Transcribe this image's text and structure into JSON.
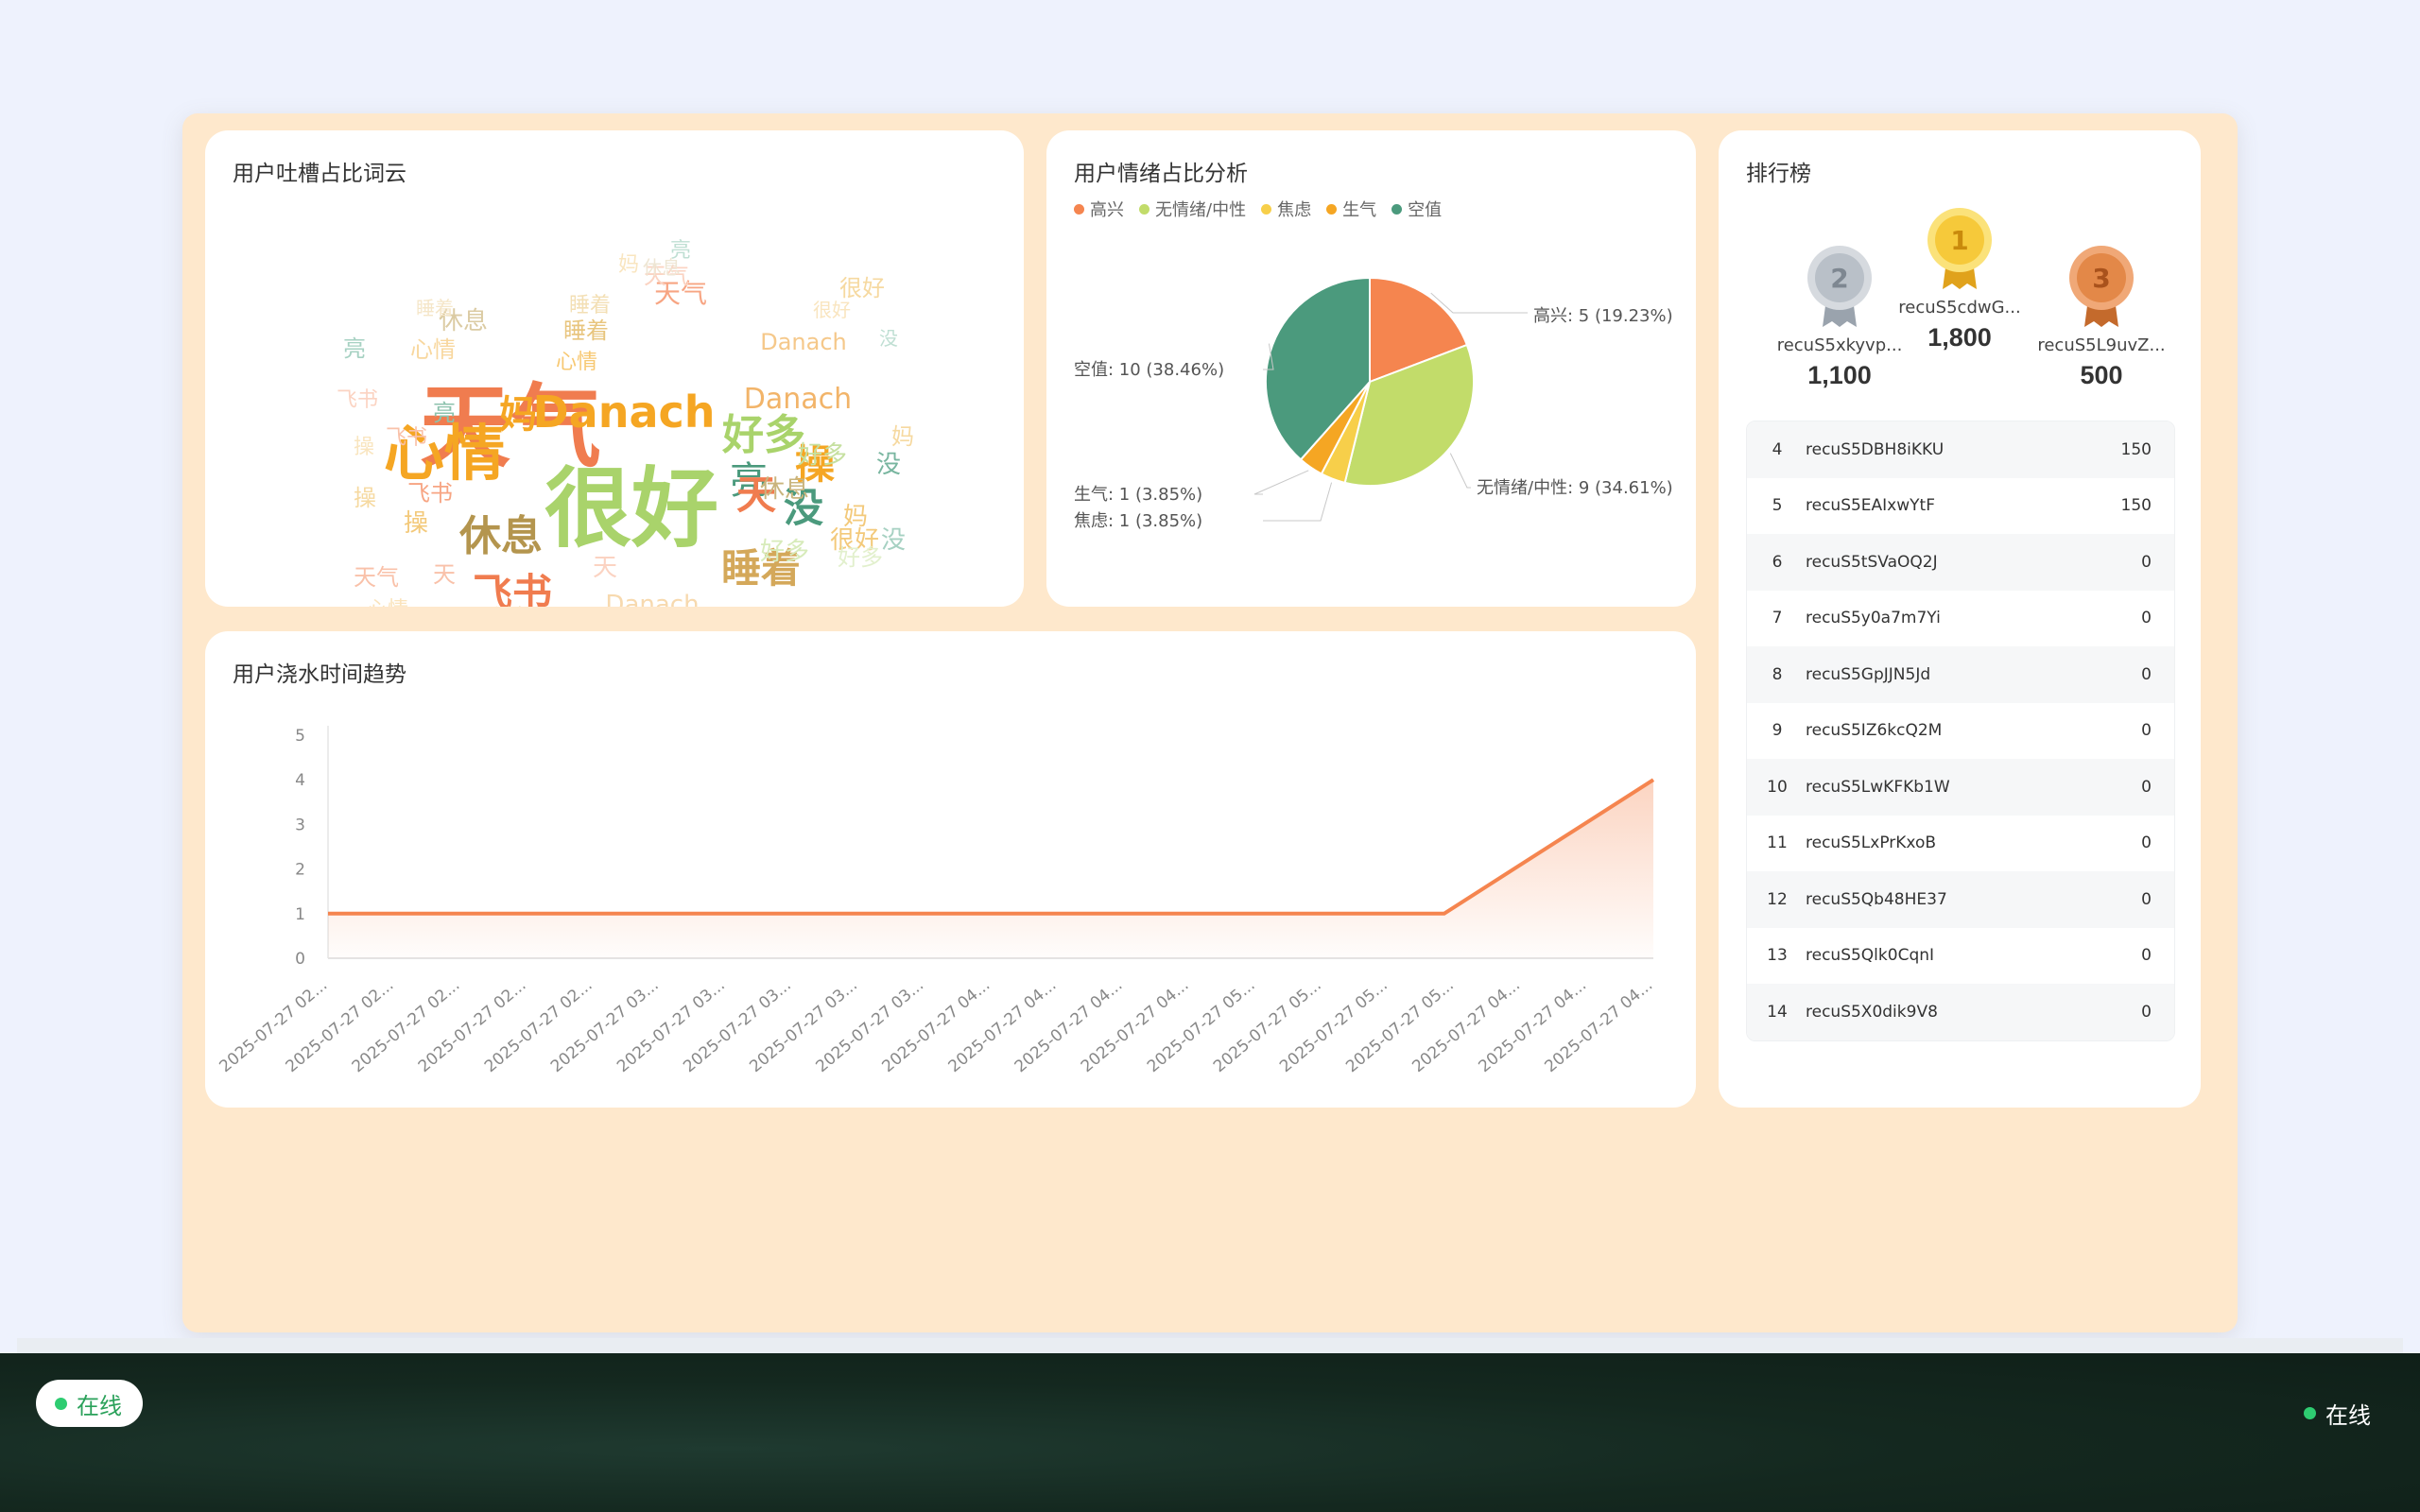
{
  "cards": {
    "wordcloud_title": "用户吐槽占比词云",
    "pie_title": "用户情绪占比分析",
    "trend_title": "用户浇水时间趋势",
    "rank_title": "排行榜"
  },
  "wordcloud_words": [
    {
      "text": "天气",
      "color": "#f07c4f"
    },
    {
      "text": "很好",
      "color": "#a9d36b"
    },
    {
      "text": "心情",
      "color": "#f5a623"
    },
    {
      "text": "Danach",
      "color": "#f5a623"
    },
    {
      "text": "妈",
      "color": "#f5a623"
    },
    {
      "text": "好多",
      "color": "#a9d36b"
    },
    {
      "text": "亮",
      "color": "#4b9a7d"
    },
    {
      "text": "操",
      "color": "#f5a623"
    },
    {
      "text": "天",
      "color": "#f07c4f"
    },
    {
      "text": "没",
      "color": "#4b9a7d"
    },
    {
      "text": "休息",
      "color": "#b4954e"
    },
    {
      "text": "飞书",
      "color": "#f07c4f"
    },
    {
      "text": "睡着",
      "color": "#d4a85a"
    },
    {
      "text": "心情",
      "color": "#f7c872"
    },
    {
      "text": "Danach",
      "color": "#f2b469"
    },
    {
      "text": "天气",
      "color": "#f7a583"
    },
    {
      "text": "休息",
      "color": "#c9b47d"
    },
    {
      "text": "好多",
      "color": "#c6e0a0"
    },
    {
      "text": "睡着",
      "color": "#e8c57e"
    },
    {
      "text": "很好",
      "color": "#f3c97a"
    },
    {
      "text": "没",
      "color": "#79b6a0"
    },
    {
      "text": "亮",
      "color": "#8cc2ad"
    },
    {
      "text": "飞书",
      "color": "#f7a583"
    },
    {
      "text": "操",
      "color": "#f3c97a"
    },
    {
      "text": "妈",
      "color": "#f3c97a"
    },
    {
      "text": "Danach",
      "color": "#f5c88a"
    },
    {
      "text": "休息",
      "color": "#dbcba3"
    },
    {
      "text": "天气",
      "color": "#f9c1a9"
    },
    {
      "text": "睡着",
      "color": "#f0d69f"
    },
    {
      "text": "好多",
      "color": "#d7ebba"
    },
    {
      "text": "心情",
      "color": "#f8d79e"
    },
    {
      "text": "亮",
      "color": "#a6d1c2"
    },
    {
      "text": "飞书",
      "color": "#f9c1a9"
    },
    {
      "text": "Danach",
      "color": "#f7d9ae"
    },
    {
      "text": "很好",
      "color": "#f6d9a0"
    },
    {
      "text": "天",
      "color": "#f9c1a9"
    },
    {
      "text": "没",
      "color": "#a6d1c2"
    },
    {
      "text": "操",
      "color": "#f6d9a0"
    },
    {
      "text": "休息",
      "color": "#e6dcc2"
    },
    {
      "text": "睡着",
      "color": "#f3dfb4"
    },
    {
      "text": "妈",
      "color": "#f6d9a0"
    },
    {
      "text": "天气",
      "color": "#fbd3c2"
    },
    {
      "text": "好多",
      "color": "#e2f0cd"
    },
    {
      "text": "心情",
      "color": "#fae3bb"
    },
    {
      "text": "飞书",
      "color": "#fbd3c2"
    },
    {
      "text": "亮",
      "color": "#bfdfd3"
    },
    {
      "text": "Danach",
      "color": "#f9e3c4"
    },
    {
      "text": "很好",
      "color": "#f9e5bf"
    },
    {
      "text": "休息",
      "color": "#eee6d4"
    },
    {
      "text": "睡着",
      "color": "#f5e6c8"
    },
    {
      "text": "天",
      "color": "#fbd3c2"
    },
    {
      "text": "操",
      "color": "#f9e5bf"
    },
    {
      "text": "妈",
      "color": "#f9e5bf"
    },
    {
      "text": "没",
      "color": "#bfdfd3"
    }
  ],
  "legend": [
    {
      "label": "高兴",
      "color": "#f5854f"
    },
    {
      "label": "无情绪/中性",
      "color": "#c2dc6a"
    },
    {
      "label": "焦虑",
      "color": "#f7cf4a"
    },
    {
      "label": "生气",
      "color": "#f5a623"
    },
    {
      "label": "空值",
      "color": "#4b9a7d"
    }
  ],
  "chart_data": [
    {
      "type": "pie",
      "title": "用户情绪占比分析",
      "categories": [
        "高兴",
        "无情绪/中性",
        "焦虑",
        "生气",
        "空值"
      ],
      "values": [
        5,
        9,
        1,
        1,
        10
      ],
      "labels": [
        "高兴: 5 (19.23%)",
        "无情绪/中性: 9 (34.61%)",
        "焦虑: 1 (3.85%)",
        "生气: 1 (3.85%)",
        "空值: 10 (38.46%)"
      ],
      "colors": [
        "#f5854f",
        "#c2dc6a",
        "#f7cf4a",
        "#f5a623",
        "#4b9a7d"
      ],
      "legend": "top-left"
    },
    {
      "type": "area",
      "title": "用户浇水时间趋势",
      "categories": [
        "2025-07-27 02...",
        "2025-07-27 02...",
        "2025-07-27 02...",
        "2025-07-27 02...",
        "2025-07-27 02...",
        "2025-07-27 03...",
        "2025-07-27 03...",
        "2025-07-27 03...",
        "2025-07-27 03...",
        "2025-07-27 03...",
        "2025-07-27 04...",
        "2025-07-27 04...",
        "2025-07-27 04...",
        "2025-07-27 04...",
        "2025-07-27 05...",
        "2025-07-27 05...",
        "2025-07-27 05...",
        "2025-07-27 05...",
        "2025-07-27 04...",
        "2025-07-27 04...",
        "2025-07-27 04..."
      ],
      "series": [
        {
          "values": [
            1,
            1,
            1,
            1,
            1,
            1,
            1,
            1,
            1,
            1,
            1,
            1,
            1,
            1,
            1,
            1,
            1,
            2,
            3,
            4
          ]
        }
      ],
      "yticks": [
        0,
        1,
        2,
        3,
        4,
        5
      ],
      "ylim": [
        0,
        5
      ],
      "grid": false,
      "color": "#f5854f"
    }
  ],
  "podium": [
    {
      "rank": "2",
      "name": "recuS5xkyvp...",
      "score": "1,100"
    },
    {
      "rank": "1",
      "name": "recuS5cdwG...",
      "score": "1,800"
    },
    {
      "rank": "3",
      "name": "recuS5L9uvZ...",
      "score": "500"
    }
  ],
  "ranking": [
    {
      "no": "4",
      "user": "recuS5DBH8iKKU",
      "score": "150"
    },
    {
      "no": "5",
      "user": "recuS5EAIxwYtF",
      "score": "150"
    },
    {
      "no": "6",
      "user": "recuS5tSVaOQ2J",
      "score": "0"
    },
    {
      "no": "7",
      "user": "recuS5y0a7m7Yi",
      "score": "0"
    },
    {
      "no": "8",
      "user": "recuS5GpJJN5Jd",
      "score": "0"
    },
    {
      "no": "9",
      "user": "recuS5IZ6kcQ2M",
      "score": "0"
    },
    {
      "no": "10",
      "user": "recuS5LwKFKb1W",
      "score": "0"
    },
    {
      "no": "11",
      "user": "recuS5LxPrKxoB",
      "score": "0"
    },
    {
      "no": "12",
      "user": "recuS5Qb48HE37",
      "score": "0"
    },
    {
      "no": "13",
      "user": "recuS5Qlk0CqnI",
      "score": "0"
    },
    {
      "no": "14",
      "user": "recuS5X0dik9V8",
      "score": "0"
    }
  ],
  "status": {
    "pill_label": "在线",
    "right_label": "在线",
    "dot_color": "#2ecc71"
  }
}
